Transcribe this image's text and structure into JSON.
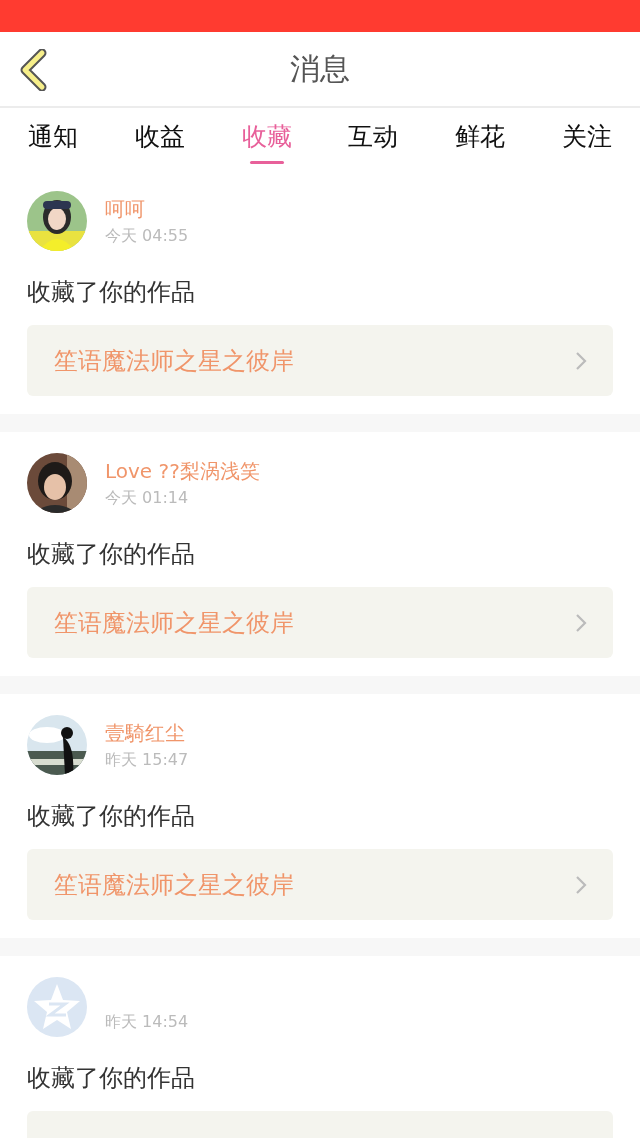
{
  "header": {
    "title": "消息"
  },
  "tabs": [
    {
      "label": "通知",
      "selected": false
    },
    {
      "label": "收益",
      "selected": false
    },
    {
      "label": "收藏",
      "selected": true
    },
    {
      "label": "互动",
      "selected": false
    },
    {
      "label": "鲜花",
      "selected": false
    },
    {
      "label": "关注",
      "selected": false
    }
  ],
  "messages": [
    {
      "name": "呵呵",
      "time": "今天 04:55",
      "action": "收藏了你的作品",
      "work": "笙语魔法师之星之彼岸"
    },
    {
      "name": "Love ??梨涡浅笑",
      "time": "今天 01:14",
      "action": "收藏了你的作品",
      "work": "笙语魔法师之星之彼岸"
    },
    {
      "name": "壹騎红尘",
      "time": "昨天 15:47",
      "action": "收藏了你的作品",
      "work": "笙语魔法师之星之彼岸"
    },
    {
      "avatar": {
        "kind": "default"
      },
      "time": "昨天 14:54",
      "action": "收藏了你的作品"
    }
  ]
}
